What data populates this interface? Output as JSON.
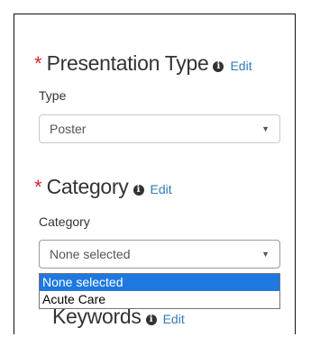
{
  "presentation_type": {
    "required_mark": "*",
    "title": "Presentation Type",
    "info_glyph": "i",
    "edit_label": "Edit",
    "field_label": "Type",
    "selected_value": "Poster"
  },
  "category": {
    "required_mark": "*",
    "title": "Category",
    "info_glyph": "i",
    "edit_label": "Edit",
    "field_label": "Category",
    "selected_value": "None selected",
    "options": [
      "None selected",
      "Acute Care"
    ],
    "highlighted_option": "None selected"
  },
  "keywords": {
    "title": "Keywords",
    "info_glyph": "i",
    "edit_label": "Edit"
  },
  "icons": {
    "info": "info-circle-icon",
    "dropdown": "caret-down-icon"
  },
  "colors": {
    "required": "#d9232d",
    "link": "#337ab7",
    "highlight": "#1e78e0"
  }
}
